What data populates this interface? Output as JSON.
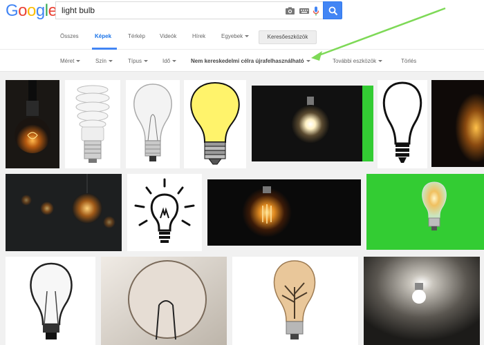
{
  "logo": {
    "letters": [
      "G",
      "o",
      "o",
      "g",
      "l",
      "e"
    ],
    "colors": [
      "#4285f4",
      "#ea4335",
      "#fbbc05",
      "#4285f4",
      "#34a853",
      "#ea4335"
    ]
  },
  "search": {
    "value": "light bulb"
  },
  "tabs": [
    {
      "label": "Összes"
    },
    {
      "label": "Képek",
      "active": true
    },
    {
      "label": "Térkép"
    },
    {
      "label": "Videók"
    },
    {
      "label": "Hírek"
    },
    {
      "label": "Egyebek"
    }
  ],
  "tools_label": "Keresőeszközök",
  "filters": [
    {
      "label": "Méret"
    },
    {
      "label": "Szín"
    },
    {
      "label": "Típus"
    },
    {
      "label": "Idő"
    },
    {
      "label": "Nem kereskedelmi célra újrafelhasználható"
    },
    {
      "label": "További eszközök"
    },
    {
      "label": "Törlés"
    }
  ],
  "colors": {
    "accent": "#4285f4",
    "annotation": "#7ed957",
    "green_screen": "#33cc33"
  },
  "images": [
    {
      "name": "image-result-1",
      "style": "dark-glow"
    },
    {
      "name": "image-result-2",
      "style": "cfl-white"
    },
    {
      "name": "image-result-3",
      "style": "clear-bulb"
    },
    {
      "name": "image-result-4",
      "style": "yellow-cartoon"
    },
    {
      "name": "image-result-5",
      "style": "dark-bright"
    },
    {
      "name": "image-result-6",
      "style": "outline"
    },
    {
      "name": "image-result-7",
      "style": "dark-glow-edge"
    },
    {
      "name": "image-result-8",
      "style": "hanging-bulbs"
    },
    {
      "name": "image-result-9",
      "style": "icon-rays"
    },
    {
      "name": "image-result-10",
      "style": "vintage-filament"
    },
    {
      "name": "image-result-11",
      "style": "green-screen"
    },
    {
      "name": "image-result-12",
      "style": "sketch"
    },
    {
      "name": "image-result-13",
      "style": "macro-bulb"
    },
    {
      "name": "image-result-14",
      "style": "tree-bulb"
    },
    {
      "name": "image-result-15",
      "style": "ceiling-bulb"
    }
  ]
}
